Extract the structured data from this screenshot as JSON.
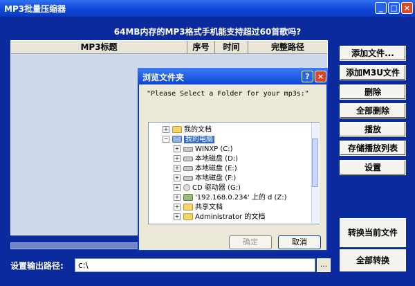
{
  "window": {
    "title": "MP3批量压缩器"
  },
  "question": "64MB内存的MP3格式手机能支持超过60首歌吗?",
  "list": {
    "columns": [
      "MP3标题",
      "序号",
      "时间",
      "完整路径"
    ]
  },
  "buttons": {
    "add_file": "添加文件...",
    "add_m3u": "添加M3U文件",
    "delete": "删除",
    "delete_all": "全部删除",
    "play": "播放",
    "save_playlist": "存储播放列表",
    "settings": "设置",
    "convert_current": "转换当前文件",
    "convert_all": "全部转换"
  },
  "output": {
    "label": "设置输出路径:",
    "value": "c:\\",
    "browse": "..."
  },
  "dialog": {
    "title": "浏览文件夹",
    "prompt": "\"Please Select a Folder for your mp3s:\"",
    "tree": [
      {
        "label": "我的文档",
        "icon": "folder-icon"
      },
      {
        "label": "我的电脑",
        "icon": "computer-icon",
        "selected": true
      },
      {
        "label": "WINXP (C:)",
        "icon": "drive-icon"
      },
      {
        "label": "本地磁盘 (D:)",
        "icon": "drive-icon"
      },
      {
        "label": "本地磁盘 (E:)",
        "icon": "drive-icon"
      },
      {
        "label": "本地磁盘 (F:)",
        "icon": "drive-icon"
      },
      {
        "label": "CD 驱动器 (G:)",
        "icon": "cd-icon"
      },
      {
        "label": "'192.168.0.234' 上的 d (Z:)",
        "icon": "network-drive-icon"
      },
      {
        "label": "共享文档",
        "icon": "folder-icon"
      },
      {
        "label": "Administrator 的文档",
        "icon": "folder-icon"
      }
    ],
    "ok": "确定",
    "cancel": "取消"
  }
}
